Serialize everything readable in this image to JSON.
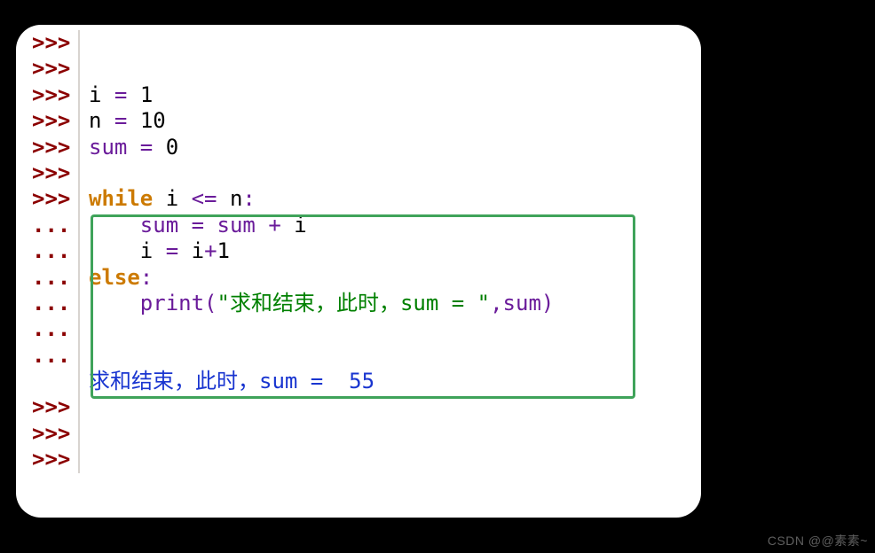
{
  "prompts": {
    "primary": ">>>",
    "continuation": "..."
  },
  "code": {
    "assign_i_var": "i",
    "eq": " = ",
    "assign_i_val": "1",
    "assign_n_var": "n",
    "assign_n_val": "10",
    "assign_sum_var": "sum",
    "assign_sum_val": "0",
    "while_kw": "while",
    "while_cond_sp": " ",
    "while_var_i": "i",
    "while_le": " <= ",
    "while_var_n": "n",
    "colon": ":",
    "indent": "    ",
    "sum_assign_lhs": "sum",
    "sum_assign_eq": " = ",
    "sum_assign_rhs1": "sum",
    "sum_assign_plus": " + ",
    "sum_assign_rhs2": "i",
    "i_assign_lhs": "i",
    "i_assign_eq": " = ",
    "i_assign_rhs1": "i",
    "i_assign_plus": "+",
    "i_assign_rhs2": "1",
    "else_kw": "else",
    "print_fn": "print",
    "paren_open": "(",
    "print_str": "\"求和结束，此时，sum = \"",
    "comma": ",",
    "print_arg": "sum",
    "paren_close": ")"
  },
  "output": "求和结束，此时，sum =  55",
  "watermark": "CSDN @@素素~"
}
